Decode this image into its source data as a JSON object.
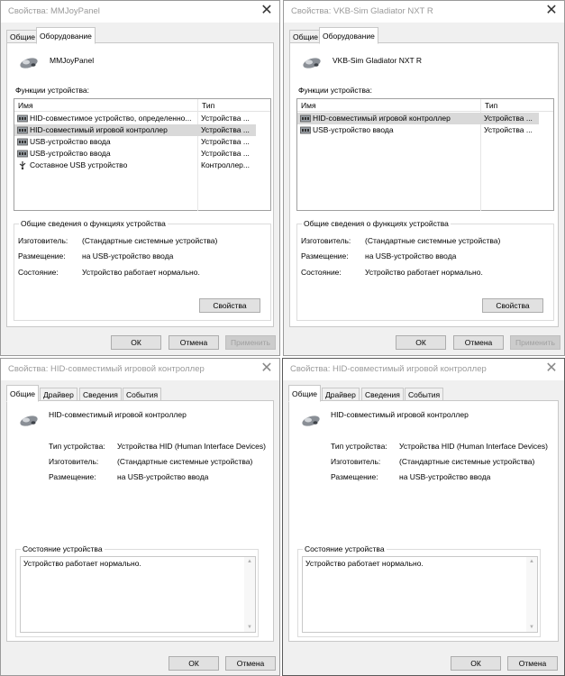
{
  "colors": {
    "window_bg": "#f0f0f0",
    "panel_bg": "#ffffff",
    "selection": "#d9d9d9",
    "title_text": "#9a9a9a",
    "button_bg": "#e1e1e1"
  },
  "icons": {
    "device": "gamepad-icon",
    "usb": "usb-icon",
    "close": "close-icon"
  },
  "win1": {
    "title": "Свойства: MMJoyPanel",
    "tabs": [
      "Общие",
      "Оборудование"
    ],
    "device_name": "MMJoyPanel",
    "functions_label": "Функции устройства:",
    "columns": [
      "Имя",
      "Тип"
    ],
    "rows": [
      {
        "name": "HID-совместимое устройство, определенно...",
        "type": "Устройства ...",
        "icon": "hid-device-icon"
      },
      {
        "name": "HID-совместимый игровой контроллер",
        "type": "Устройства ...",
        "icon": "hid-device-icon"
      },
      {
        "name": "USB-устройство ввода",
        "type": "Устройства ...",
        "icon": "hid-device-icon"
      },
      {
        "name": "USB-устройство ввода",
        "type": "Устройства ...",
        "icon": "hid-device-icon"
      },
      {
        "name": "Составное USB устройство",
        "type": "Контроллер...",
        "icon": "usb-icon"
      }
    ],
    "group_title": "Общие сведения о функциях устройства",
    "labels": {
      "manufacturer": "Изготовитель:",
      "location": "Размещение:",
      "status": "Состояние:"
    },
    "values": {
      "manufacturer": "(Стандартные системные устройства)",
      "location": "на USB-устройство ввода",
      "status": "Устройство работает нормально."
    },
    "buttons": {
      "properties": "Свойства",
      "ok": "ОК",
      "cancel": "Отмена",
      "apply": "Применить"
    }
  },
  "win2": {
    "title": "Свойства: VKB-Sim Gladiator NXT R",
    "tabs": [
      "Общие",
      "Оборудование"
    ],
    "device_name": "VKB-Sim Gladiator NXT R",
    "functions_label": "Функции устройства:",
    "columns": [
      "Имя",
      "Тип"
    ],
    "rows": [
      {
        "name": "HID-совместимый игровой контроллер",
        "type": "Устройства ...",
        "icon": "hid-device-icon"
      },
      {
        "name": "USB-устройство ввода",
        "type": "Устройства ...",
        "icon": "hid-device-icon"
      }
    ],
    "group_title": "Общие сведения о функциях устройства",
    "labels": {
      "manufacturer": "Изготовитель:",
      "location": "Размещение:",
      "status": "Состояние:"
    },
    "values": {
      "manufacturer": "(Стандартные системные устройства)",
      "location": "на USB-устройство ввода",
      "status": "Устройство работает нормально."
    },
    "buttons": {
      "properties": "Свойства",
      "ok": "ОК",
      "cancel": "Отмена",
      "apply": "Применить"
    }
  },
  "win3": {
    "title": "Свойства: HID-совместимый игровой контроллер",
    "tabs": [
      "Общие",
      "Драйвер",
      "Сведения",
      "События"
    ],
    "device_name": "HID-совместимый игровой контроллер",
    "labels": {
      "type": "Тип устройства:",
      "manufacturer": "Изготовитель:",
      "location": "Размещение:"
    },
    "values": {
      "type": "Устройства HID (Human Interface Devices)",
      "manufacturer": "(Стандартные системные устройства)",
      "location": "на USB-устройство ввода"
    },
    "status_title": "Состояние устройства",
    "status_text": "Устройство работает нормально.",
    "buttons": {
      "ok": "ОК",
      "cancel": "Отмена"
    }
  },
  "win4": {
    "title": "Свойства: HID-совместимый игровой контроллер",
    "tabs": [
      "Общие",
      "Драйвер",
      "Сведения",
      "События"
    ],
    "device_name": "HID-совместимый игровой контроллер",
    "labels": {
      "type": "Тип устройства:",
      "manufacturer": "Изготовитель:",
      "location": "Размещение:"
    },
    "values": {
      "type": "Устройства HID (Human Interface Devices)",
      "manufacturer": "(Стандартные системные устройства)",
      "location": "на USB-устройство ввода"
    },
    "status_title": "Состояние устройства",
    "status_text": "Устройство работает нормально.",
    "buttons": {
      "ok": "ОК",
      "cancel": "Отмена"
    }
  }
}
